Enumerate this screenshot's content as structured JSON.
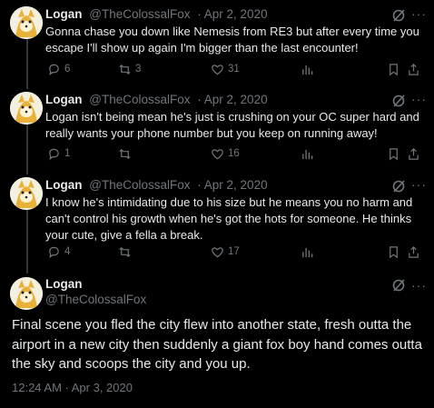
{
  "tweets": [
    {
      "name": "Logan",
      "handle": "@TheColossalFox",
      "date": "· Apr 2, 2020",
      "text": "Gonna chase you down like Nemesis from RE3 but after every time you escape I'll show up again I'm bigger than the last encounter!",
      "replies": "6",
      "retweets": "3",
      "likes": "31"
    },
    {
      "name": "Logan",
      "handle": "@TheColossalFox",
      "date": "· Apr 2, 2020",
      "text": "Logan isn't being mean he's just is crushing on your OC super hard and really wants your phone number but you keep on running away!",
      "replies": "1",
      "retweets": "",
      "likes": "16"
    },
    {
      "name": "Logan",
      "handle": "@TheColossalFox",
      "date": "· Apr 2, 2020",
      "text": "I know he's intimidating due to his size but he means you no harm and can't control his growth when he's got the hots for someone. He thinks your cute, give a fella a break.",
      "replies": "4",
      "retweets": "",
      "likes": "17"
    }
  ],
  "main": {
    "name": "Logan",
    "handle": "@TheColossalFox",
    "text": "Final scene you fled the city flew into another state, fresh outta the airport in a new city then suddenly a giant fox boy hand comes outta the sky and scoops the city and you up.",
    "timestamp": "12:24 AM · Apr 3, 2020"
  },
  "icons": {
    "reply": "reply-icon",
    "retweet": "retweet-icon",
    "like": "heart-icon",
    "views": "views-icon",
    "bookmark": "bookmark-icon",
    "share": "share-icon",
    "grok": "grok-icon",
    "more": "more-icon"
  },
  "colors": {
    "background": "#000000",
    "text": "#e7e9ea",
    "muted": "#71767b",
    "thread_line": "#333639"
  }
}
